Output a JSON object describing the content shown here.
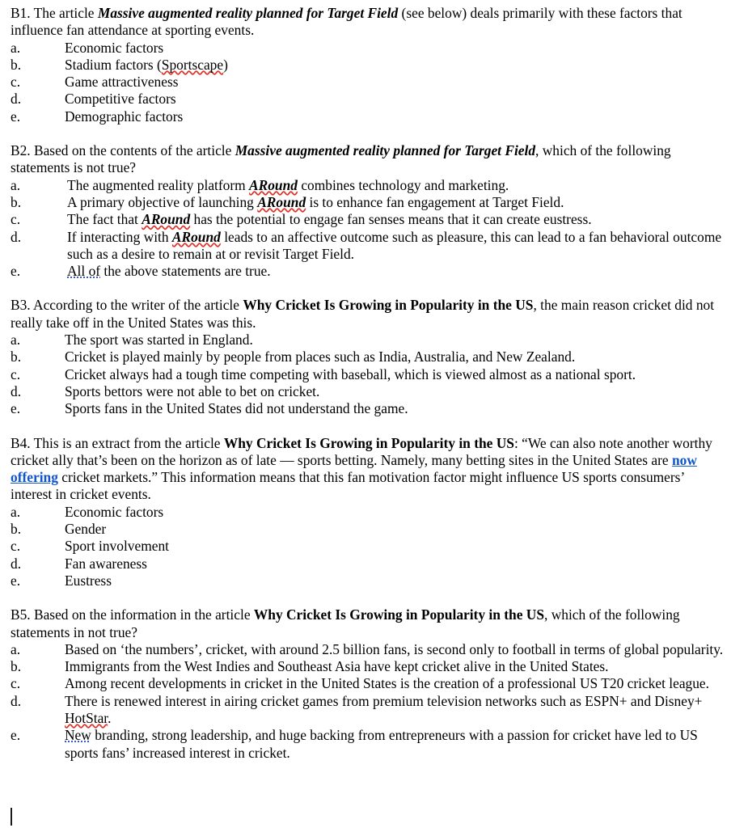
{
  "document": {
    "background_color": "#ffffff",
    "text_color": "#000000",
    "spellcheck_underline_color": "#e03127",
    "grammar_underline_color": "#3b58c8",
    "link_color": "#1155cc"
  },
  "questions": [
    {
      "id": "B1",
      "stem_parts": [
        {
          "text": "B1. The article ",
          "style": "normal"
        },
        {
          "text": "Massive augmented reality planned for Target Field",
          "style": "bold-italic"
        },
        {
          "text": " (see below) deals primarily with these factors that influence fan attendance at sporting events.",
          "style": "normal"
        }
      ],
      "options": [
        {
          "marker": "a.",
          "parts": [
            {
              "text": "Economic factors",
              "style": "normal"
            }
          ]
        },
        {
          "marker": "b.",
          "parts": [
            {
              "text": "Stadium factors (",
              "style": "normal"
            },
            {
              "text": "Sportscape",
              "style": "spellcheck"
            },
            {
              "text": ")",
              "style": "normal"
            }
          ]
        },
        {
          "marker": "c.",
          "parts": [
            {
              "text": "Game attractiveness",
              "style": "normal"
            }
          ]
        },
        {
          "marker": "d.",
          "parts": [
            {
              "text": "Competitive factors",
              "style": "normal"
            }
          ]
        },
        {
          "marker": "e.",
          "parts": [
            {
              "text": "Demographic factors",
              "style": "normal"
            }
          ]
        }
      ]
    },
    {
      "id": "B2",
      "stem_parts": [
        {
          "text": "B2. Based on the contents of the article ",
          "style": "normal"
        },
        {
          "text": "Massive augmented reality planned for Target Field",
          "style": "bold-italic"
        },
        {
          "text": ", which of the following statements is not true?",
          "style": "normal"
        }
      ],
      "options": [
        {
          "marker": "a.",
          "parts": [
            {
              "text": "The augmented reality platform ",
              "style": "normal"
            },
            {
              "text": "ARound",
              "style": "bold-italic-spellcheck"
            },
            {
              "text": " combines technology and marketing.",
              "style": "normal"
            }
          ]
        },
        {
          "marker": "b.",
          "parts": [
            {
              "text": "A primary objective of launching ",
              "style": "normal"
            },
            {
              "text": "ARound",
              "style": "bold-italic-spellcheck"
            },
            {
              "text": " is to enhance fan engagement at Target Field.",
              "style": "normal"
            }
          ]
        },
        {
          "marker": "c.",
          "parts": [
            {
              "text": "The fact that ",
              "style": "normal"
            },
            {
              "text": "ARound",
              "style": "bold-italic-spellcheck"
            },
            {
              "text": " has the potential to engage fan senses means that it can create eustress.",
              "style": "normal"
            }
          ]
        },
        {
          "marker": "d.",
          "parts": [
            {
              "text": "If interacting with ",
              "style": "normal"
            },
            {
              "text": "ARound",
              "style": "bold-italic-spellcheck"
            },
            {
              "text": " leads to an affective outcome such as pleasure, this can lead to a fan behavioral outcome such as a desire to remain at or revisit Target Field.",
              "style": "normal"
            }
          ]
        },
        {
          "marker": "e.",
          "parts": [
            {
              "text": "All of",
              "style": "grammar"
            },
            {
              "text": " the above statements are true.",
              "style": "normal"
            }
          ]
        }
      ]
    },
    {
      "id": "B3",
      "stem_parts": [
        {
          "text": "B3. According to the writer of the article ",
          "style": "normal"
        },
        {
          "text": "Why Cricket Is Growing in Popularity in the US",
          "style": "bold"
        },
        {
          "text": ", the main reason cricket did not really take off in the United States was this.",
          "style": "normal"
        }
      ],
      "options": [
        {
          "marker": "a.",
          "parts": [
            {
              "text": "The sport was started in England.",
              "style": "normal"
            }
          ]
        },
        {
          "marker": "b.",
          "parts": [
            {
              "text": "Cricket is played mainly by people from places such as India, Australia, and New Zealand.",
              "style": "normal"
            }
          ]
        },
        {
          "marker": "c.",
          "parts": [
            {
              "text": "Cricket always had a tough time competing with baseball, which is viewed almost as a national sport.",
              "style": "normal"
            }
          ]
        },
        {
          "marker": "d.",
          "parts": [
            {
              "text": "Sports bettors were not able to bet on cricket.",
              "style": "normal"
            }
          ]
        },
        {
          "marker": "e.",
          "parts": [
            {
              "text": "Sports fans in the United States did not understand the game.",
              "style": "normal"
            }
          ]
        }
      ]
    },
    {
      "id": "B4",
      "stem_parts": [
        {
          "text": "B4. This is an extract from the article ",
          "style": "normal"
        },
        {
          "text": "Why Cricket Is Growing in Popularity in the US",
          "style": "bold"
        },
        {
          "text": ": “We can also note another worthy cricket ally that’s been on the horizon as of late — sports betting. Namely, many betting sites in the United States are ",
          "style": "normal"
        },
        {
          "text": "now offering",
          "style": "link"
        },
        {
          "text": " cricket markets.”  This information means that this fan motivation factor might influence US sports consumers’ interest in cricket events.",
          "style": "normal"
        }
      ],
      "options": [
        {
          "marker": "a.",
          "parts": [
            {
              "text": "Economic factors",
              "style": "normal"
            }
          ]
        },
        {
          "marker": "b.",
          "parts": [
            {
              "text": "Gender",
              "style": "normal"
            }
          ]
        },
        {
          "marker": "c.",
          "parts": [
            {
              "text": "Sport involvement",
              "style": "normal"
            }
          ]
        },
        {
          "marker": "d.",
          "parts": [
            {
              "text": "Fan awareness",
              "style": "normal"
            }
          ]
        },
        {
          "marker": "e.",
          "parts": [
            {
              "text": "Eustress",
              "style": "normal"
            }
          ]
        }
      ]
    },
    {
      "id": "B5",
      "stem_parts": [
        {
          "text": "B5. Based on the information in the article ",
          "style": "normal"
        },
        {
          "text": "Why Cricket Is Growing in Popularity in the US",
          "style": "bold"
        },
        {
          "text": ", which of the following statements in not true?",
          "style": "normal"
        }
      ],
      "options": [
        {
          "marker": "a.",
          "parts": [
            {
              "text": "Based on ‘the numbers’, cricket, with around 2.5 billion fans, is second only to football in terms of global popularity.",
              "style": "normal"
            }
          ]
        },
        {
          "marker": "b.",
          "parts": [
            {
              "text": "Immigrants from the West Indies and Southeast Asia have kept cricket alive in the United States.",
              "style": "normal"
            }
          ]
        },
        {
          "marker": "c.",
          "parts": [
            {
              "text": "Among recent developments in cricket in the United States is the creation of a professional US T20 cricket league.",
              "style": "normal"
            }
          ]
        },
        {
          "marker": "d.",
          "parts": [
            {
              "text": "There is renewed interest in airing cricket games from premium television networks such as ESPN+ and Disney+ ",
              "style": "normal"
            },
            {
              "text": "HotStar",
              "style": "spellcheck"
            },
            {
              "text": ".",
              "style": "normal"
            }
          ]
        },
        {
          "marker": "e.",
          "parts": [
            {
              "text": "New",
              "style": "grammar"
            },
            {
              "text": " branding, strong leadership, and huge backing from entrepreneurs with a passion for cricket have led to US sports fans’ increased interest in cricket.",
              "style": "normal"
            }
          ]
        }
      ]
    }
  ]
}
